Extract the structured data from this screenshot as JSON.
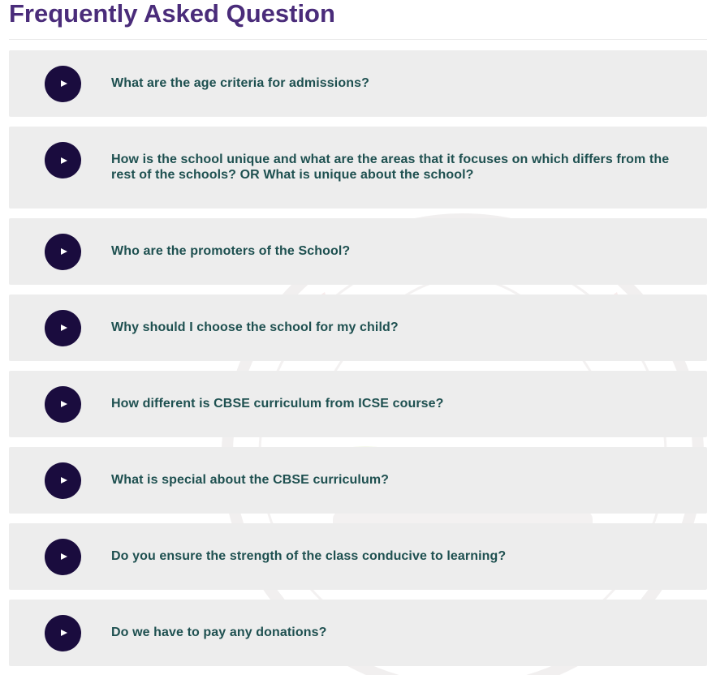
{
  "header": {
    "title": "Frequently Asked Question"
  },
  "colors": {
    "title": "#4a2c7a",
    "question_text": "#1e5050",
    "play_button": "#1a0c3e",
    "item_background": "#ececec"
  },
  "faq": {
    "items": [
      {
        "question": "What are the age criteria for admissions?",
        "icon": "play-icon"
      },
      {
        "question": "How is the school unique and what are the areas that it focuses on which differs from the rest of the schools? OR What is unique about the school?",
        "icon": "play-icon"
      },
      {
        "question": "Who are the promoters of the School?",
        "icon": "play-icon"
      },
      {
        "question": "Why should I choose the school for my child?",
        "icon": "play-icon"
      },
      {
        "question": "How different is CBSE curriculum from ICSE course?",
        "icon": "play-icon"
      },
      {
        "question": "What is special about the CBSE curriculum?",
        "icon": "play-icon"
      },
      {
        "question": "Do you ensure the strength of the class conducive to learning?",
        "icon": "play-icon"
      },
      {
        "question": "Do we have to pay any donations?",
        "icon": "play-icon"
      }
    ]
  }
}
